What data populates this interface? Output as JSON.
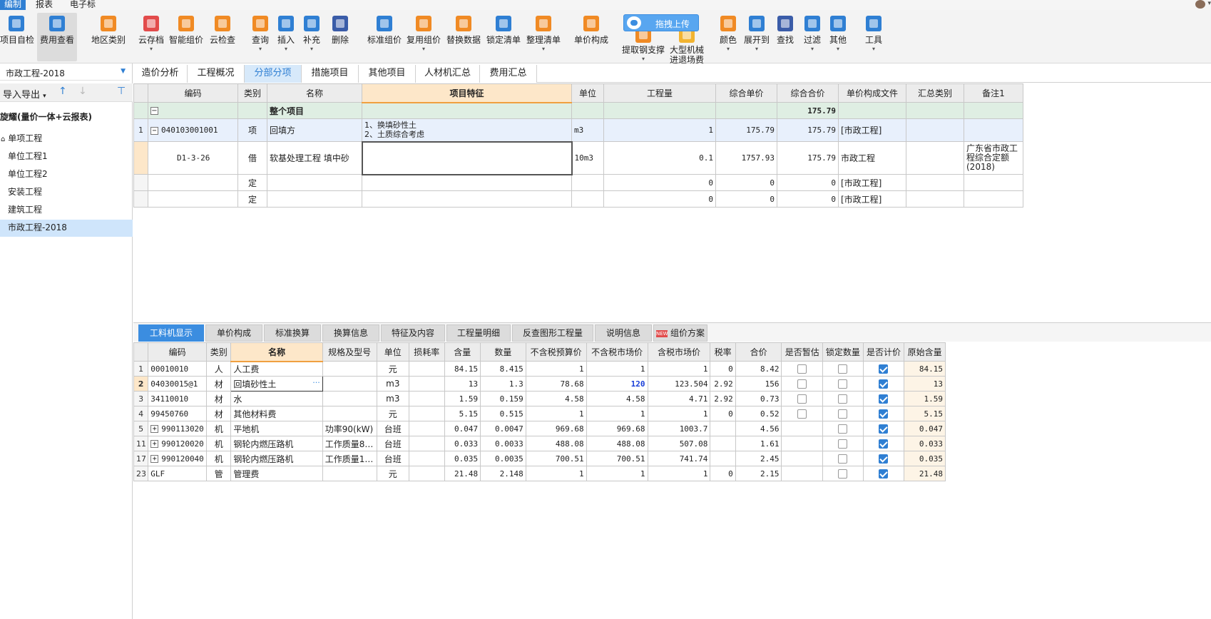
{
  "menubar": {
    "items": [
      "编制",
      "报表",
      "电子标"
    ],
    "caret": "▾"
  },
  "ribbon": {
    "upload_label": "拖拽上传",
    "buttons": [
      {
        "label": "项目自检",
        "icon": "check-doc-icon"
      },
      {
        "label": "费用查看",
        "icon": "yuan-search-icon"
      },
      {
        "label": "地区类别",
        "icon": "region-list-icon"
      },
      {
        "label": "云存档",
        "icon": "cloud-save-icon",
        "caret": "▾"
      },
      {
        "label": "智能组价",
        "icon": "smart-price-icon"
      },
      {
        "label": "云检查",
        "icon": "cloud-check-icon"
      },
      {
        "label": "查询",
        "icon": "query-icon",
        "caret": "▾"
      },
      {
        "label": "插入",
        "icon": "insert-icon",
        "caret": "▾"
      },
      {
        "label": "补充",
        "icon": "supplement-icon",
        "caret": "▾"
      },
      {
        "label": "删除",
        "icon": "trash-icon"
      },
      {
        "label": "标准组价",
        "icon": "standard-price-icon"
      },
      {
        "label": "复用组价",
        "icon": "reuse-price-icon",
        "caret": "▾"
      },
      {
        "label": "替换数据",
        "icon": "replace-data-icon"
      },
      {
        "label": "锁定清单",
        "icon": "lock-icon"
      },
      {
        "label": "整理清单",
        "icon": "organize-list-icon",
        "caret": "▾"
      },
      {
        "label": "单价构成",
        "icon": "unit-price-icon"
      },
      {
        "label": "提取钢支撑",
        "icon": "steel-support-icon",
        "caret": "▾"
      },
      {
        "label": "大型机械\n进退场费",
        "icon": "machinery-icon"
      },
      {
        "label": "颜色",
        "icon": "color-icon",
        "caret": "▾"
      },
      {
        "label": "展开到",
        "icon": "expand-icon",
        "caret": "▾"
      },
      {
        "label": "查找",
        "icon": "binoculars-icon"
      },
      {
        "label": "过滤",
        "icon": "filter-icon",
        "caret": "▾"
      },
      {
        "label": "其他",
        "icon": "more-grid-icon",
        "caret": "▾"
      },
      {
        "label": "工具",
        "icon": "tools-icon",
        "caret": "▾"
      }
    ]
  },
  "left": {
    "project_select": "市政工程-2018",
    "import_export": "导入导出",
    "root_label": "旋耀(量价一体+云报表)",
    "tree": [
      "单项工程",
      "单位工程1",
      "单位工程2",
      "安装工程",
      "建筑工程",
      "市政工程-2018"
    ]
  },
  "main_tabs": [
    "造价分析",
    "工程概况",
    "分部分项",
    "措施项目",
    "其他项目",
    "人材机汇总",
    "费用汇总"
  ],
  "top_table": {
    "headers": [
      "编码",
      "类别",
      "名称",
      "项目特征",
      "单位",
      "工程量",
      "综合单价",
      "综合合价",
      "单价构成文件",
      "汇总类别",
      "备注1"
    ],
    "total_row": {
      "name": "整个项目",
      "total": "175.79",
      "toggle": "−"
    },
    "rows": [
      {
        "num": "1",
        "code": "040103001001",
        "type": "项",
        "name": "回填方",
        "feature1": "1、换填砂性土",
        "feature2": "2、土质综合考虑",
        "unit": "m3",
        "qty": "1",
        "uprice": "175.79",
        "total": "175.79",
        "file": "[市政工程]",
        "cat": "",
        "note": "",
        "toggle": "−"
      },
      {
        "num": "",
        "code": "D1-3-26",
        "type": "借",
        "name": "软基处理工程 填中砂",
        "feature1": "",
        "feature2": "",
        "unit": "10m3",
        "qty": "0.1",
        "uprice": "1757.93",
        "total": "175.79",
        "file": "市政工程",
        "cat": "",
        "note": "广东省市政工程综合定额(2018)"
      },
      {
        "num": "",
        "code": "",
        "type": "定",
        "name": "",
        "feature1": "",
        "feature2": "",
        "unit": "",
        "qty": "0",
        "uprice": "0",
        "total": "0",
        "file": "[市政工程]",
        "cat": "",
        "note": ""
      },
      {
        "num": "",
        "code": "",
        "type": "定",
        "name": "",
        "feature1": "",
        "feature2": "",
        "unit": "",
        "qty": "0",
        "uprice": "0",
        "total": "0",
        "file": "[市政工程]",
        "cat": "",
        "note": ""
      }
    ]
  },
  "bottom_tabs": [
    "工料机显示",
    "单价构成",
    "标准换算",
    "换算信息",
    "特征及内容",
    "工程量明细",
    "反查图形工程量",
    "说明信息",
    "组价方案"
  ],
  "new_badge": "NEW",
  "bottom_table": {
    "headers": [
      "编码",
      "类别",
      "名称",
      "规格及型号",
      "单位",
      "损耗率",
      "含量",
      "数量",
      "不含税预算价",
      "不含税市场价",
      "含税市场价",
      "税率",
      "合价",
      "是否暂估",
      "锁定数量",
      "是否计价",
      "原始含量"
    ],
    "rows": [
      {
        "num": "1",
        "code": "00010010",
        "type": "人",
        "name": "人工费",
        "spec": "",
        "unit": "元",
        "loss": "",
        "content": "84.15",
        "qty": "8.415",
        "pre": "1",
        "mkt": "1",
        "mkt_tax": "1",
        "tax": "0",
        "total": "8.42",
        "est": false,
        "lock": false,
        "priced": true,
        "orig": "84.15"
      },
      {
        "num": "2",
        "code": "04030015@1",
        "type": "材",
        "name": "回填砂性土",
        "spec": "",
        "unit": "m3",
        "loss": "",
        "content": "13",
        "qty": "1.3",
        "pre": "78.68",
        "mkt": "120",
        "mkt_tax": "123.504",
        "tax": "2.92",
        "total": "156",
        "est": false,
        "lock": false,
        "priced": true,
        "orig": "13"
      },
      {
        "num": "3",
        "code": "34110010",
        "type": "材",
        "name": "水",
        "spec": "",
        "unit": "m3",
        "loss": "",
        "content": "1.59",
        "qty": "0.159",
        "pre": "4.58",
        "mkt": "4.58",
        "mkt_tax": "4.71",
        "tax": "2.92",
        "total": "0.73",
        "est": false,
        "lock": false,
        "priced": true,
        "orig": "1.59"
      },
      {
        "num": "4",
        "code": "99450760",
        "type": "材",
        "name": "其他材料费",
        "spec": "",
        "unit": "元",
        "loss": "",
        "content": "5.15",
        "qty": "0.515",
        "pre": "1",
        "mkt": "1",
        "mkt_tax": "1",
        "tax": "0",
        "total": "0.52",
        "est": false,
        "lock": false,
        "priced": true,
        "orig": "5.15"
      },
      {
        "num": "5",
        "code": "990113020",
        "type": "机",
        "name": "平地机",
        "spec": "功率90(kW)",
        "unit": "台班",
        "loss": "",
        "content": "0.047",
        "qty": "0.0047",
        "pre": "969.68",
        "mkt": "969.68",
        "mkt_tax": "1003.7",
        "tax": "",
        "total": "4.56",
        "est": null,
        "lock": false,
        "priced": true,
        "orig": "0.047",
        "plus": "+"
      },
      {
        "num": "11",
        "code": "990120020",
        "type": "机",
        "name": "钢轮内燃压路机",
        "spec": "工作质量8…",
        "unit": "台班",
        "loss": "",
        "content": "0.033",
        "qty": "0.0033",
        "pre": "488.08",
        "mkt": "488.08",
        "mkt_tax": "507.08",
        "tax": "",
        "total": "1.61",
        "est": null,
        "lock": false,
        "priced": true,
        "orig": "0.033",
        "plus": "+"
      },
      {
        "num": "17",
        "code": "990120040",
        "type": "机",
        "name": "钢轮内燃压路机",
        "spec": "工作质量1…",
        "unit": "台班",
        "loss": "",
        "content": "0.035",
        "qty": "0.0035",
        "pre": "700.51",
        "mkt": "700.51",
        "mkt_tax": "741.74",
        "tax": "",
        "total": "2.45",
        "est": null,
        "lock": false,
        "priced": true,
        "orig": "0.035",
        "plus": "+"
      },
      {
        "num": "23",
        "code": "GLF",
        "type": "管",
        "name": "管理费",
        "spec": "",
        "unit": "元",
        "loss": "",
        "content": "21.48",
        "qty": "2.148",
        "pre": "1",
        "mkt": "1",
        "mkt_tax": "1",
        "tax": "0",
        "total": "2.15",
        "est": null,
        "lock": false,
        "priced": true,
        "orig": "21.48"
      }
    ]
  },
  "colors": {
    "accent": "#2f7fd3",
    "tab_active": "#3b8de0",
    "total_row": "#dfeee3",
    "header_highlight": "#fde7c9"
  }
}
